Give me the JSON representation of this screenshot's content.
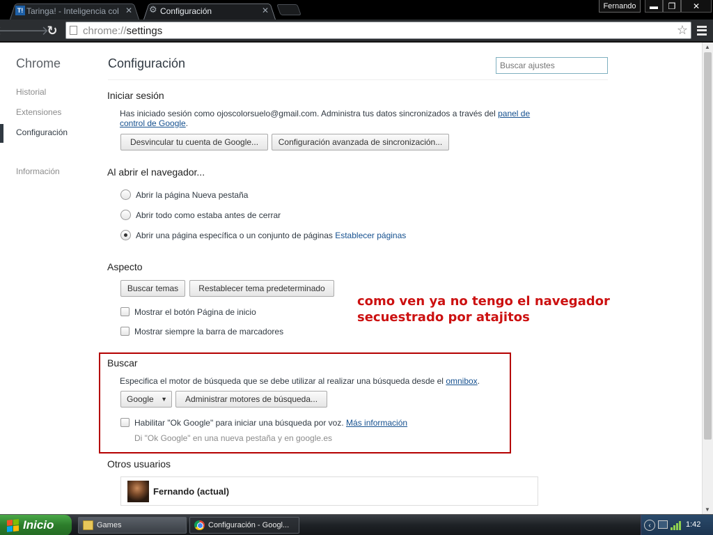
{
  "tabs": [
    {
      "title": "Taringa! - Inteligencia colecti",
      "favicon": "T!"
    },
    {
      "title": "Configuración",
      "favicon": "gear-icon"
    }
  ],
  "profile": "Fernando",
  "window_buttons": {
    "minimize": "▬",
    "maximize": "❐",
    "close": "✕"
  },
  "omnibox": {
    "scheme": "chrome://",
    "path": "settings"
  },
  "sidebar": {
    "brand": "Chrome",
    "items": [
      "Historial",
      "Extensiones",
      "Configuración",
      "Información"
    ]
  },
  "header": {
    "title": "Configuración",
    "search_placeholder": "Buscar ajustes"
  },
  "sign_in": {
    "title": "Iniciar sesión",
    "text": "Has iniciado sesión como ojoscolorsuelo@gmail.com. Administra tus datos sincronizados a través del",
    "link_line1": "panel de",
    "link_line2": "control de Google",
    "period": ".",
    "buttons": [
      "Desvincular tu cuenta de Google...",
      "Configuración avanzada de sincronización..."
    ]
  },
  "startup": {
    "title": "Al abrir el navegador...",
    "options": [
      "Abrir la página Nueva pestaña",
      "Abrir todo como estaba antes de cerrar",
      "Abrir una página específica o un conjunto de páginas"
    ],
    "selected": 2,
    "set_pages_link": "Establecer páginas"
  },
  "appearance": {
    "title": "Aspecto",
    "buttons": [
      "Buscar temas",
      "Restablecer tema predeterminado"
    ],
    "checkboxes": [
      "Mostrar el botón Página de inicio",
      "Mostrar siempre la barra de marcadores"
    ]
  },
  "annotation": {
    "line1": "como ven ya no tengo el navegador",
    "line2": "secuestrado por atajitos",
    "color": "#cc1111"
  },
  "search": {
    "title": "Buscar",
    "text": "Especifica el motor de búsqueda que se debe utilizar al realizar una búsqueda desde el",
    "omnibox_link": "omnibox",
    "period": ".",
    "engine": "Google",
    "manage_button": "Administrar motores de búsqueda...",
    "ok_google_label": "Habilitar \"Ok Google\" para iniciar una búsqueda por voz.",
    "more_info_link": "Más información",
    "hint": "Di \"Ok Google\" en una nueva pestaña y en google.es"
  },
  "users": {
    "title": "Otros usuarios",
    "current": "Fernando (actual)"
  },
  "taskbar": {
    "start_label": "Inicio",
    "items": [
      "Games",
      "Configuración - Googl..."
    ],
    "clock": "1:42"
  }
}
